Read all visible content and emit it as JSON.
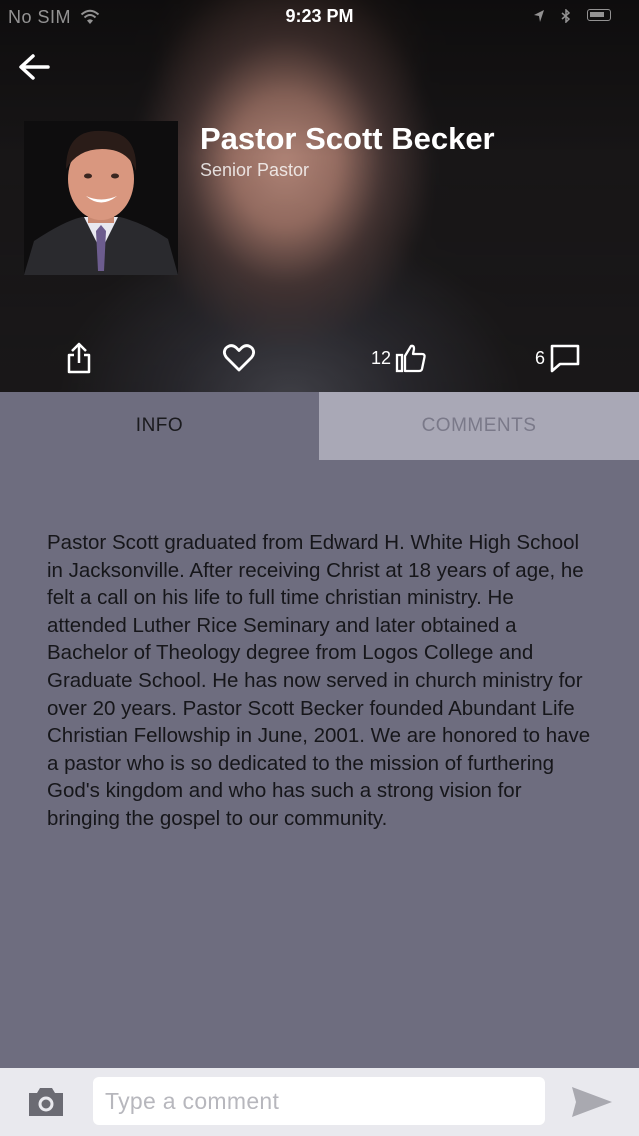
{
  "status_bar": {
    "carrier": "No SIM",
    "time": "9:23 PM"
  },
  "profile": {
    "name": "Pastor Scott Becker",
    "title": "Senior Pastor"
  },
  "actions": {
    "share_icon": "share-icon",
    "favorite_icon": "heart-icon",
    "like_count": "12",
    "like_icon": "thumbs-up-icon",
    "comment_count": "6",
    "comment_icon": "speech-bubble-icon"
  },
  "tabs": [
    {
      "label": "INFO",
      "active": true
    },
    {
      "label": "COMMENTS",
      "active": false
    }
  ],
  "bio": "Pastor Scott graduated from Edward H. White High School in Jacksonville. After receiving Christ at 18 years of age, he felt a call on his life to full time christian ministry. He attended Luther Rice Seminary and later obtained a Bachelor of Theology degree from Logos College and Graduate School. He has now served in church ministry for over 20 years. Pastor Scott Becker founded Abundant Life Christian Fellowship in June, 2001. We are honored to have a pastor who is so dedicated to the mission of furthering God's kingdom and who has such a strong vision for bringing the gospel to our community.",
  "comment_bar": {
    "placeholder": "Type a comment",
    "camera_icon": "camera-icon",
    "send_icon": "send-icon"
  },
  "colors": {
    "content_bg": "#6e6d7f",
    "inactive_tab_bg": "#a9a8b6",
    "comment_bar_bg": "#e9e9ee"
  }
}
